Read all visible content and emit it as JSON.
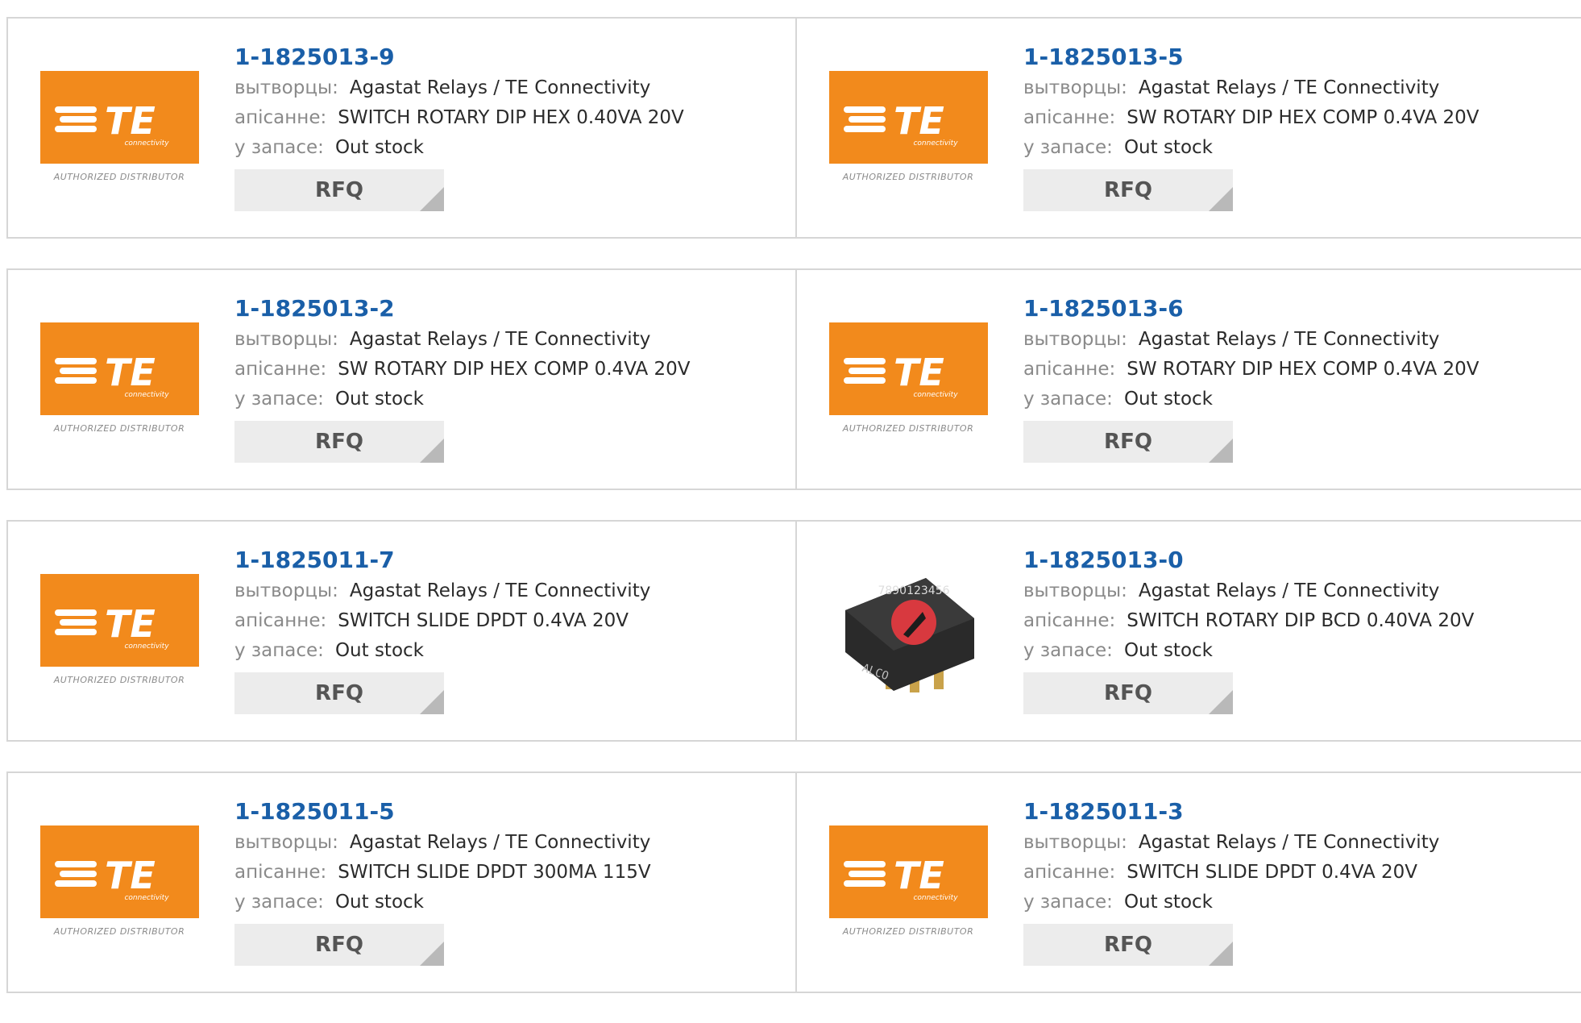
{
  "labels": {
    "manufacturer": "вытворцы:",
    "description": "апісанне:",
    "stock": "у запасе:",
    "rfq": "RFQ"
  },
  "logo": {
    "brand": "TE",
    "sub": "connectivity",
    "tagline": "AUTHORIZED DISTRIBUTOR"
  },
  "products": [
    {
      "part": "1-1825013-9",
      "manufacturer": "Agastat Relays / TE Connectivity",
      "description": "SWITCH ROTARY DIP HEX 0.40VA 20V",
      "stock": "Out stock",
      "image": "te-logo"
    },
    {
      "part": "1-1825013-5",
      "manufacturer": "Agastat Relays / TE Connectivity",
      "description": "SW ROTARY DIP HEX COMP 0.4VA 20V",
      "stock": "Out stock",
      "image": "te-logo"
    },
    {
      "part": "1-1825013-2",
      "manufacturer": "Agastat Relays / TE Connectivity",
      "description": "SW ROTARY DIP HEX COMP 0.4VA 20V",
      "stock": "Out stock",
      "image": "te-logo"
    },
    {
      "part": "1-1825013-6",
      "manufacturer": "Agastat Relays / TE Connectivity",
      "description": "SW ROTARY DIP HEX COMP 0.4VA 20V",
      "stock": "Out stock",
      "image": "te-logo"
    },
    {
      "part": "1-1825011-7",
      "manufacturer": "Agastat Relays / TE Connectivity",
      "description": "SWITCH SLIDE DPDT 0.4VA 20V",
      "stock": "Out stock",
      "image": "te-logo"
    },
    {
      "part": "1-1825013-0",
      "manufacturer": "Agastat Relays / TE Connectivity",
      "description": "SWITCH ROTARY DIP BCD 0.40VA 20V",
      "stock": "Out stock",
      "image": "rotary-switch-photo",
      "photo_digits": "7890123456",
      "photo_marking": "ALCO"
    },
    {
      "part": "1-1825011-5",
      "manufacturer": "Agastat Relays / TE Connectivity",
      "description": "SWITCH SLIDE DPDT 300MA 115V",
      "stock": "Out stock",
      "image": "te-logo"
    },
    {
      "part": "1-1825011-3",
      "manufacturer": "Agastat Relays / TE Connectivity",
      "description": "SWITCH SLIDE DPDT 0.4VA 20V",
      "stock": "Out stock",
      "image": "te-logo"
    }
  ],
  "colors": {
    "accent_link": "#1a5fa8",
    "logo_orange": "#f28a1c",
    "rfq_bg": "#ececec",
    "border": "#d6d6d6"
  }
}
